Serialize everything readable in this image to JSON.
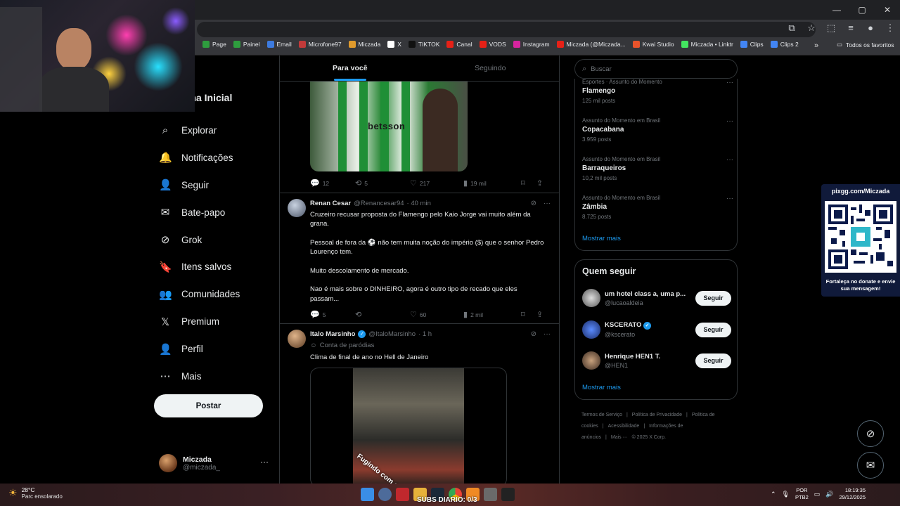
{
  "browser": {
    "bookmarks": [
      {
        "label": "Page",
        "color": "#2e9d3e"
      },
      {
        "label": "Painel",
        "color": "#2e9d3e"
      },
      {
        "label": "Email",
        "color": "#3d7be0"
      },
      {
        "label": "Microfone97",
        "color": "#c23a3a"
      },
      {
        "label": "Miczada",
        "color": "#e09a2c"
      },
      {
        "label": "X",
        "color": "#ffffff"
      },
      {
        "label": "TIKTOK",
        "color": "#111111"
      },
      {
        "label": "Canal",
        "color": "#e62117"
      },
      {
        "label": "VODS",
        "color": "#e62117"
      },
      {
        "label": "Instagram",
        "color": "#d6249f"
      },
      {
        "label": "Miczada (@Miczada...",
        "color": "#e62117"
      },
      {
        "label": "Kwai Studio",
        "color": "#e8532b"
      },
      {
        "label": "Miczada • Linktr",
        "color": "#43e660"
      },
      {
        "label": "Clips",
        "color": "#4285f4"
      },
      {
        "label": "Clips 2",
        "color": "#4285f4"
      }
    ],
    "all_favorites": "Todos os favoritos"
  },
  "nav": {
    "title": "gina Inicial",
    "items": [
      {
        "label": "Explorar",
        "icon": "⌕"
      },
      {
        "label": "Notificações",
        "icon": "🔔"
      },
      {
        "label": "Seguir",
        "icon": "👤"
      },
      {
        "label": "Bate-papo",
        "icon": "✉"
      },
      {
        "label": "Grok",
        "icon": "⊘"
      },
      {
        "label": "Itens salvos",
        "icon": "🔖"
      },
      {
        "label": "Comunidades",
        "icon": "👥"
      },
      {
        "label": "Premium",
        "icon": "𝕏"
      },
      {
        "label": "Perfil",
        "icon": "👤"
      },
      {
        "label": "Mais",
        "icon": "⋯"
      }
    ],
    "post_button": "Postar",
    "account": {
      "name": "Miczada",
      "handle": "@miczada_",
      "more": "···"
    }
  },
  "feed": {
    "tabs": [
      "Para você",
      "Seguindo"
    ],
    "post1": {
      "media_text": "betsson",
      "replies": "12",
      "reposts": "5",
      "likes": "217",
      "views": "19 mil"
    },
    "post2": {
      "name": "Renan Cesar",
      "handle": "@Renancesar94",
      "time": "· 40 min",
      "paragraphs": [
        "Cruzeiro recusar proposta do Flamengo pelo Kaio Jorge vai muito além da grana.",
        "Pessoal de fora da ⚽ não tem muita noção do império ($) que o senhor Pedro Lourenço tem.",
        "Muito descolamento de mercado.",
        "Nao é mais sobre o DINHEIRO, agora é outro tipo de recado que eles passam..."
      ],
      "replies": "5",
      "reposts": "",
      "likes": "60",
      "views": "2 mil"
    },
    "post3": {
      "name": "Italo Marsinho",
      "handle": "@ItaloMarsinho",
      "time": "· 1 h",
      "label": "Conta de paródias",
      "text": "Clima de final de ano no Hell de Janeiro",
      "media_caption": "Fugindo com o Prato"
    }
  },
  "sidebar": {
    "search_placeholder": "Buscar",
    "trends": [
      {
        "category": "Esportes · Assunto do Momento",
        "name": "Flamengo",
        "count": "125 mil posts"
      },
      {
        "category": "Assunto do Momento em Brasil",
        "name": "Copacabana",
        "count": "3.959 posts"
      },
      {
        "category": "Assunto do Momento em Brasil",
        "name": "Barraqueiros",
        "count": "10,2 mil posts"
      },
      {
        "category": "Assunto do Momento em Brasil",
        "name": "Zâmbia",
        "count": "8.725 posts"
      }
    ],
    "trends_more": "Mostrar mais",
    "who_title": "Quem seguir",
    "who": [
      {
        "name": "um hotel class a, uma p...",
        "handle": "@lucaoaldeia",
        "verified": false,
        "button": "Seguir"
      },
      {
        "name": "KSCERATO",
        "handle": "@kscerato",
        "verified": true,
        "button": "Seguir"
      },
      {
        "name": "Henrique HEN1 T.",
        "handle": "@HEN1",
        "verified": false,
        "button": "Seguir"
      }
    ],
    "who_more": "Mostrar mais",
    "footer": [
      "Termos de Serviço",
      "|",
      "Política de Privacidade",
      "|",
      "Política de cookies",
      "|",
      "Acessibilidade",
      "|",
      "Informações de anúncios",
      "|",
      "Mais ···",
      "© 2025 X Corp."
    ]
  },
  "qr_widget": {
    "url": "pixgg.com/Miczada",
    "note": "Fortaleça no donate e envie sua mensagem!"
  },
  "taskbar": {
    "temp": "28°C",
    "weather": "Parc ensolarado",
    "subs": "SUBS DIARIO: 0/3",
    "lang_top": "POR",
    "lang_bottom": "PTB2",
    "time": "18:19:35",
    "date": "29/12/2025"
  }
}
